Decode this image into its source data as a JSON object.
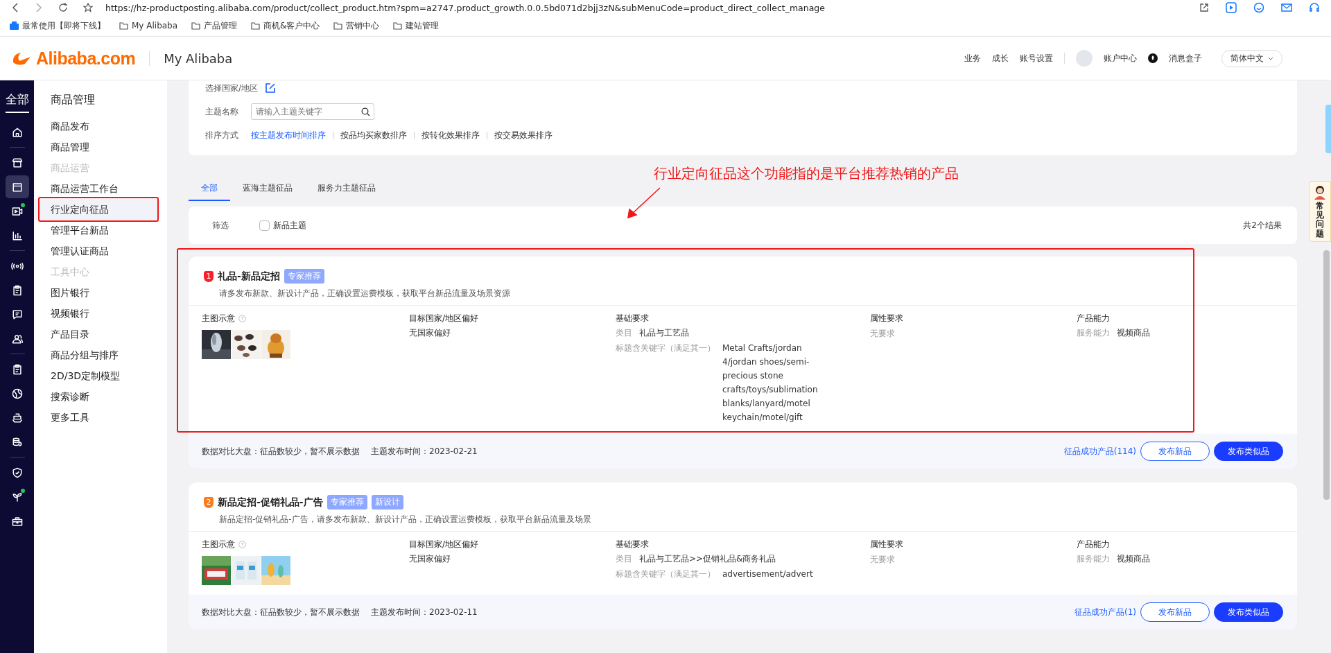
{
  "browser": {
    "url": "https://hz-productposting.alibaba.com/product/collect_product.htm?spm=a2747.product_growth.0.0.5bd071d2bjj3zN&subMenuCode=product_direct_collect_manage",
    "bookmarks": [
      {
        "kind": "apps",
        "label": "最常使用【即将下线】"
      },
      {
        "kind": "folder",
        "label": "My Alibaba"
      },
      {
        "kind": "folder",
        "label": "产品管理"
      },
      {
        "kind": "folder",
        "label": "商机&客户中心"
      },
      {
        "kind": "folder",
        "label": "营销中心"
      },
      {
        "kind": "folder",
        "label": "建站管理"
      }
    ]
  },
  "header": {
    "logo": "Alibaba.com",
    "title": "My Alibaba",
    "nav": [
      "业务",
      "成长",
      "账号设置"
    ],
    "account": "账户中心",
    "messages": "消息盒子",
    "language": "简体中文"
  },
  "rail": {
    "label": "全部",
    "groups": [
      [
        {
          "kind": "home",
          "selected": false,
          "dot": false
        }
      ],
      [
        {
          "kind": "store",
          "selected": false,
          "dot": false
        },
        {
          "kind": "box",
          "selected": true,
          "dot": false
        },
        {
          "kind": "video",
          "selected": false,
          "dot": true
        },
        {
          "kind": "chart",
          "selected": false,
          "dot": false
        }
      ],
      [
        {
          "kind": "signal",
          "selected": false,
          "dot": false
        },
        {
          "kind": "clipboard",
          "selected": false,
          "dot": false
        },
        {
          "kind": "chat",
          "selected": false,
          "dot": false
        },
        {
          "kind": "people",
          "selected": false,
          "dot": false
        }
      ],
      [
        {
          "kind": "clipboard",
          "selected": false,
          "dot": false
        },
        {
          "kind": "globe",
          "selected": false,
          "dot": false
        },
        {
          "kind": "ship",
          "selected": false,
          "dot": false
        },
        {
          "kind": "coins",
          "selected": false,
          "dot": false
        }
      ],
      [
        {
          "kind": "shield",
          "selected": false,
          "dot": false
        },
        {
          "kind": "sprout",
          "selected": false,
          "dot": true
        },
        {
          "kind": "toolbox",
          "selected": false,
          "dot": false
        }
      ]
    ]
  },
  "sidebar": {
    "title": "商品管理",
    "items": [
      {
        "kind": "link",
        "label": "商品发布",
        "selected": false,
        "annotated": false
      },
      {
        "kind": "link",
        "label": "商品管理",
        "selected": false,
        "annotated": false
      },
      {
        "kind": "section",
        "label": "商品运营"
      },
      {
        "kind": "link",
        "label": "商品运营工作台",
        "selected": false,
        "annotated": false
      },
      {
        "kind": "link",
        "label": "行业定向征品",
        "selected": true,
        "annotated": true
      },
      {
        "kind": "link",
        "label": "管理平台新品",
        "selected": false,
        "annotated": false
      },
      {
        "kind": "link",
        "label": "管理认证商品",
        "selected": false,
        "annotated": false
      },
      {
        "kind": "section",
        "label": "工具中心"
      },
      {
        "kind": "link",
        "label": "图片银行",
        "selected": false,
        "annotated": false
      },
      {
        "kind": "link",
        "label": "视频银行",
        "selected": false,
        "annotated": false
      },
      {
        "kind": "link",
        "label": "产品目录",
        "selected": false,
        "annotated": false
      },
      {
        "kind": "link",
        "label": "商品分组与排序",
        "selected": false,
        "annotated": false
      },
      {
        "kind": "link",
        "label": "2D/3D定制模型",
        "selected": false,
        "annotated": false
      },
      {
        "kind": "link",
        "label": "搜索诊断",
        "selected": false,
        "annotated": false
      },
      {
        "kind": "link",
        "label": "更多工具",
        "selected": false,
        "annotated": false
      }
    ]
  },
  "filters": {
    "region_label": "选择国家/地区",
    "theme_label": "主题名称",
    "theme_placeholder": "请输入主题关键字",
    "sort_label": "排序方式",
    "sort_options": [
      {
        "label": "按主题发布时间排序",
        "selected": true
      },
      {
        "label": "按品均买家数排序",
        "selected": false
      },
      {
        "label": "按转化效果排序",
        "selected": false
      },
      {
        "label": "按交易效果排序",
        "selected": false
      }
    ]
  },
  "tabs": [
    {
      "label": "全部",
      "selected": true
    },
    {
      "label": "蓝海主题征品",
      "selected": false
    },
    {
      "label": "服务力主题征品",
      "selected": false
    }
  ],
  "annotation": {
    "text": "行业定向征品这个功能指的是平台推荐热销的产品"
  },
  "filter_bar": {
    "label": "筛选",
    "checkbox": {
      "label": "新品主题",
      "checked": false
    },
    "result_count": "共2个结果"
  },
  "help_tab": {
    "label": "常见问题"
  },
  "themes": [
    {
      "rank": "1",
      "color": "#f5222d",
      "title": "礼品-新品定招",
      "tags": [
        "专家推荐"
      ],
      "description": "请多发布新款、新设计产品，正确设置运费模板，获取平台新品流量及场景资源",
      "annotated": true,
      "image_label": "主图示意",
      "pictures": [
        {
          "kind": "picture"
        },
        {
          "kind": "picture"
        },
        {
          "kind": "picture"
        }
      ],
      "target_title": "目标国家/地区偏好",
      "target_value": "无国家偏好",
      "basic_title": "基础要求",
      "category_label": "类目",
      "category": "礼品与工艺品",
      "keyword_label": "标题含关键字（满足其一）",
      "keywords": "Metal Crafts/jordan 4/jordan shoes/semi-precious stone crafts/toys/sublimation blanks/lanyard/motel keychain/motel/gift",
      "attr_title": "属性要求",
      "attr_value": "无要求",
      "ability_title": "产品能力",
      "ability_label": "服务能力",
      "ability_value": "视频商品",
      "stats": "数据对比大盘：征品数较少，暂不展示数据",
      "date": "主题发布时间：2023-02-21",
      "success": "征品成功产品(114)",
      "primary_button": "发布类似品",
      "secondary_button": "发布新品"
    },
    {
      "rank": "2",
      "color": "#ff7a1a",
      "title": "新品定招-促销礼品-广告",
      "tags": [
        "专家推荐",
        "新设计"
      ],
      "description": "新品定招-促销礼品-广告，请多发布新款、新设计产品，正确设置运费模板，获取平台新品流量及场景",
      "annotated": false,
      "image_label": "主图示意",
      "pictures": [
        {
          "kind": "picture"
        },
        {
          "kind": "picture"
        },
        {
          "kind": "picture"
        }
      ],
      "target_title": "目标国家/地区偏好",
      "target_value": "无国家偏好",
      "basic_title": "基础要求",
      "category_label": "类目",
      "category": "礼品与工艺品>>促销礼品&商务礼品",
      "keyword_label": "标题含关键字（满足其一）",
      "keywords": "advertisement/advert",
      "attr_title": "属性要求",
      "attr_value": "无要求",
      "ability_title": "产品能力",
      "ability_label": "服务能力",
      "ability_value": "视频商品",
      "stats": "数据对比大盘：征品数较少，暂不展示数据",
      "date": "主题发布时间：2023-02-11",
      "success": "征品成功产品(1)",
      "primary_button": "发布类似品",
      "secondary_button": "发布新品"
    }
  ]
}
